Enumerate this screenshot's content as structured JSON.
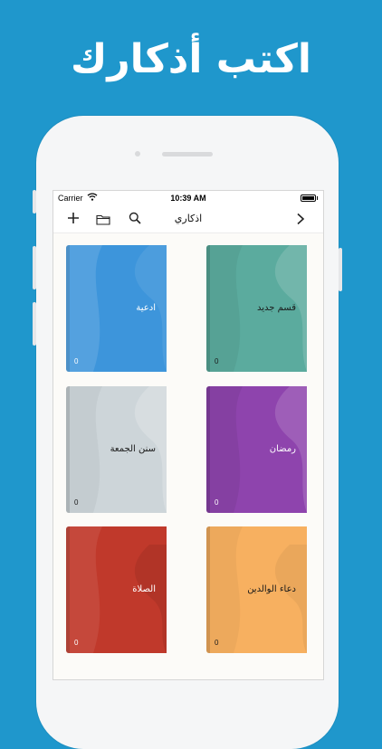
{
  "headline": "اكتب أذكارك",
  "status_bar": {
    "carrier": "Carrier",
    "time": "10:39 AM"
  },
  "nav": {
    "title": "اذكاري",
    "add_icon": "plus-icon",
    "folder_icon": "folder-icon",
    "search_icon": "search-icon",
    "forward_icon": "chevron-right-icon"
  },
  "books": [
    {
      "title": "قسم جديد",
      "count": "0",
      "color": "#5bab9e",
      "text_color": "#1a1a1a"
    },
    {
      "title": "ادعية",
      "count": "0",
      "color": "#3d95db",
      "text_color": "#ffffff"
    },
    {
      "title": "رمضان",
      "count": "0",
      "color": "#8e44ad",
      "text_color": "#ffffff"
    },
    {
      "title": "سنن الجمعة",
      "count": "0",
      "color": "#cdd5d9",
      "text_color": "#1a1a1a"
    },
    {
      "title": "دعاء الوالدين",
      "count": "0",
      "color": "#f7b060",
      "text_color": "#1a1a1a"
    },
    {
      "title": "الصلاة",
      "count": "0",
      "color": "#c0392b",
      "text_color": "#ffffff"
    }
  ],
  "colors": {
    "background": "#1f97cc",
    "phone": "#f5f6f7"
  }
}
